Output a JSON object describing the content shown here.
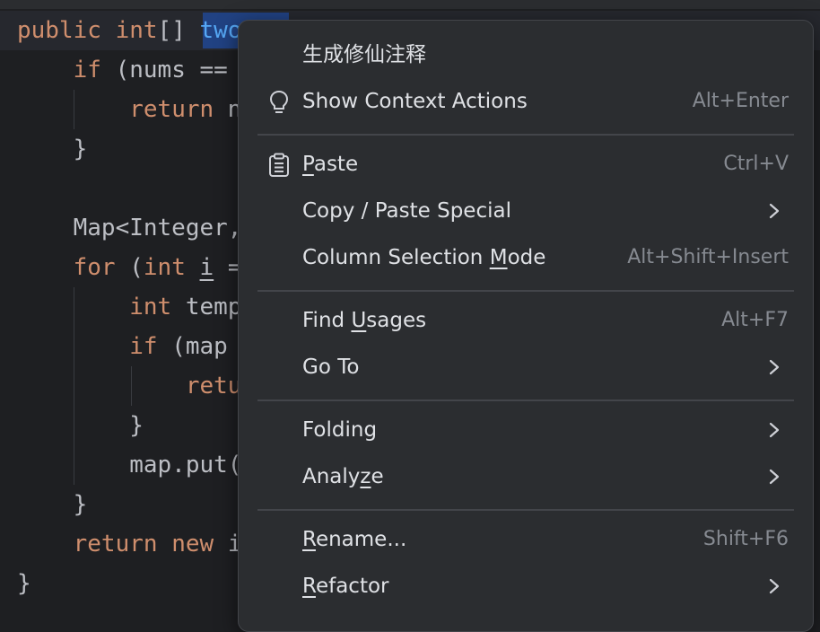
{
  "editor": {
    "lines": [
      {
        "parts": [
          {
            "t": "public int",
            "c": "kw"
          },
          {
            "t": "[] "
          },
          {
            "t": "two",
            "c": "fn"
          }
        ]
      },
      {
        "parts": [
          {
            "t": "    "
          },
          {
            "t": "if",
            "c": "kw"
          },
          {
            "t": " (nums == "
          }
        ]
      },
      {
        "parts": [
          {
            "t": "        "
          },
          {
            "t": "return",
            "c": "kw"
          },
          {
            "t": " n"
          }
        ]
      },
      {
        "parts": [
          {
            "t": "    }"
          }
        ]
      },
      {
        "parts": [
          {
            "t": ""
          }
        ]
      },
      {
        "parts": [
          {
            "t": "    Map<Integer,"
          }
        ]
      },
      {
        "parts": [
          {
            "t": "    "
          },
          {
            "t": "for",
            "c": "kw"
          },
          {
            "t": " ("
          },
          {
            "t": "int",
            "c": "kw"
          },
          {
            "t": " "
          },
          {
            "t": "i",
            "c": "ul"
          },
          {
            "t": " = "
          }
        ]
      },
      {
        "parts": [
          {
            "t": "        "
          },
          {
            "t": "int",
            "c": "kw"
          },
          {
            "t": " temp"
          }
        ]
      },
      {
        "parts": [
          {
            "t": "        "
          },
          {
            "t": "if",
            "c": "kw"
          },
          {
            "t": " (map"
          }
        ]
      },
      {
        "parts": [
          {
            "t": "            "
          },
          {
            "t": "retu",
            "c": "kw"
          }
        ]
      },
      {
        "parts": [
          {
            "t": "        }"
          }
        ]
      },
      {
        "parts": [
          {
            "t": "        map.put("
          }
        ]
      },
      {
        "parts": [
          {
            "t": "    }"
          }
        ]
      },
      {
        "parts": [
          {
            "t": "    "
          },
          {
            "t": "return new",
            "c": "kw"
          },
          {
            "t": " i"
          }
        ]
      },
      {
        "parts": [
          {
            "t": "}"
          }
        ]
      }
    ]
  },
  "menu": {
    "items": [
      {
        "name": "menu-item-generate-comment",
        "label": "生成修仙注释",
        "icon": "",
        "shortcut": "",
        "submenu": false
      },
      {
        "name": "menu-item-show-context-actions",
        "label": "Show Context Actions",
        "icon": "lightbulb-icon",
        "shortcut": "Alt+Enter",
        "submenu": false
      },
      {
        "sep": true
      },
      {
        "name": "menu-item-paste",
        "label": "Paste",
        "mnemonic": 0,
        "icon": "clipboard-icon",
        "shortcut": "Ctrl+V",
        "submenu": false
      },
      {
        "name": "menu-item-copy-paste-special",
        "label": "Copy / Paste Special",
        "icon": "",
        "shortcut": "",
        "submenu": true
      },
      {
        "name": "menu-item-column-selection-mode",
        "label": "Column Selection Mode",
        "mnemonic": 17,
        "icon": "",
        "shortcut": "Alt+Shift+Insert",
        "submenu": false
      },
      {
        "sep": true
      },
      {
        "name": "menu-item-find-usages",
        "label": "Find Usages",
        "mnemonic": 5,
        "icon": "",
        "shortcut": "Alt+F7",
        "submenu": false
      },
      {
        "name": "menu-item-go-to",
        "label": "Go To",
        "icon": "",
        "shortcut": "",
        "submenu": true
      },
      {
        "sep": true
      },
      {
        "name": "menu-item-folding",
        "label": "Folding",
        "icon": "",
        "shortcut": "",
        "submenu": true
      },
      {
        "name": "menu-item-analyze",
        "label": "Analyze",
        "mnemonic": 5,
        "icon": "",
        "shortcut": "",
        "submenu": true
      },
      {
        "sep": true
      },
      {
        "name": "menu-item-rename",
        "label": "Rename...",
        "mnemonic": 0,
        "icon": "",
        "shortcut": "Shift+F6",
        "submenu": false
      },
      {
        "name": "menu-item-refactor",
        "label": "Refactor",
        "mnemonic": 0,
        "icon": "",
        "shortcut": "",
        "submenu": true
      }
    ]
  },
  "colors": {
    "editor_bg": "#1e1f22",
    "keyword": "#cf8e6d",
    "method": "#56a8f5",
    "menu_bg": "#2b2d30",
    "menu_text": "#dfe1e5",
    "shortcut_text": "#868a91"
  }
}
